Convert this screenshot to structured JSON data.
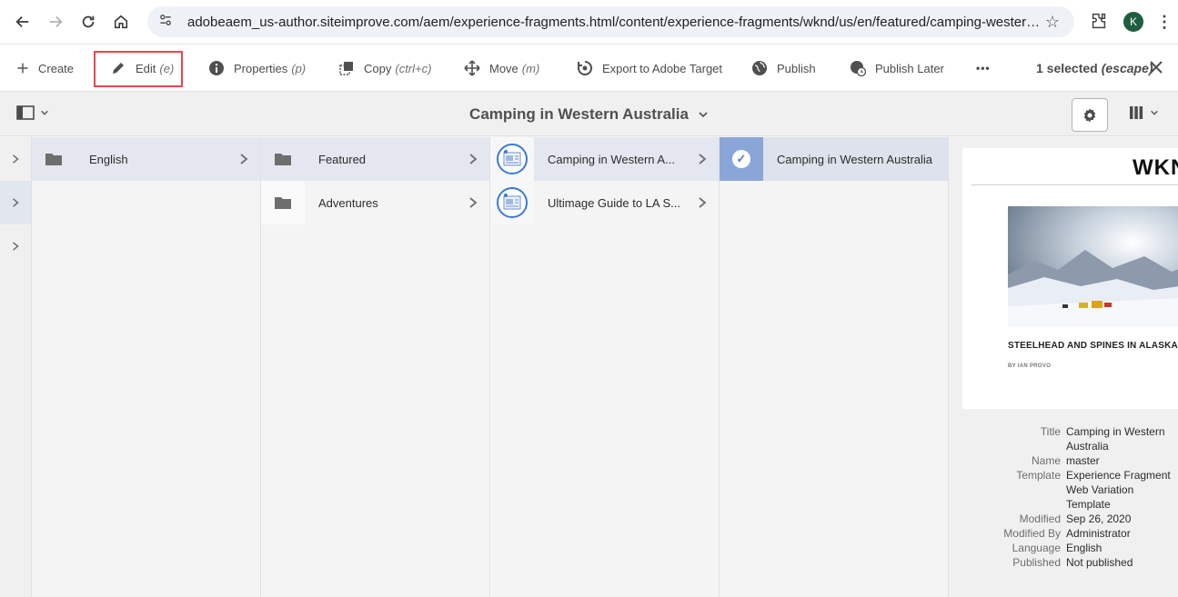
{
  "browser": {
    "url": "adobeaem_us-author.siteimprove.com/aem/experience-fragments.html/content/experience-fragments/wknd/us/en/featured/camping-western-aus...",
    "avatar_letter": "K"
  },
  "actionbar": {
    "create": "Create",
    "edit": "Edit",
    "edit_shortcut": "(e)",
    "properties": "Properties",
    "properties_shortcut": "(p)",
    "copy": "Copy",
    "copy_shortcut": "(ctrl+c)",
    "move": "Move",
    "move_shortcut": "(m)",
    "export": "Export to Adobe Target",
    "publish": "Publish",
    "publish_later": "Publish Later",
    "more": "•••",
    "selected": "1 selected",
    "selected_hint": "(escape)"
  },
  "titlebar": {
    "title": "Camping in Western Australia"
  },
  "columns": {
    "col1": [
      {
        "label": "English",
        "active": true
      }
    ],
    "col2": [
      {
        "label": "Featured",
        "active": true
      },
      {
        "label": "Adventures",
        "active": false
      }
    ],
    "col3": [
      {
        "label": "Camping in Western A...",
        "active": true
      },
      {
        "label": "Ultimage Guide to LA S...",
        "active": false
      }
    ],
    "col4": [
      {
        "label": "Camping in Western Australia",
        "selected": true
      }
    ]
  },
  "preview": {
    "logo": "WKND",
    "article_title": "STEELHEAD AND SPINES IN ALASKA",
    "byline": "BY IAN PROVO"
  },
  "meta": {
    "title_key": "Title",
    "title_val": "Camping in Western Australia",
    "name_key": "Name",
    "name_val": "master",
    "template_key": "Template",
    "template_val": "Experience Fragment Web Variation Template",
    "modified_key": "Modified",
    "modified_val": "Sep 26, 2020",
    "modified_by_key": "Modified By",
    "modified_by_val": "Administrator",
    "language_key": "Language",
    "language_val": "English",
    "published_key": "Published",
    "published_val": "Not published"
  },
  "colors": {
    "highlight": "#e34850",
    "active_row": "#e4e7ef",
    "selected_thumb": "#8aa6d8"
  }
}
